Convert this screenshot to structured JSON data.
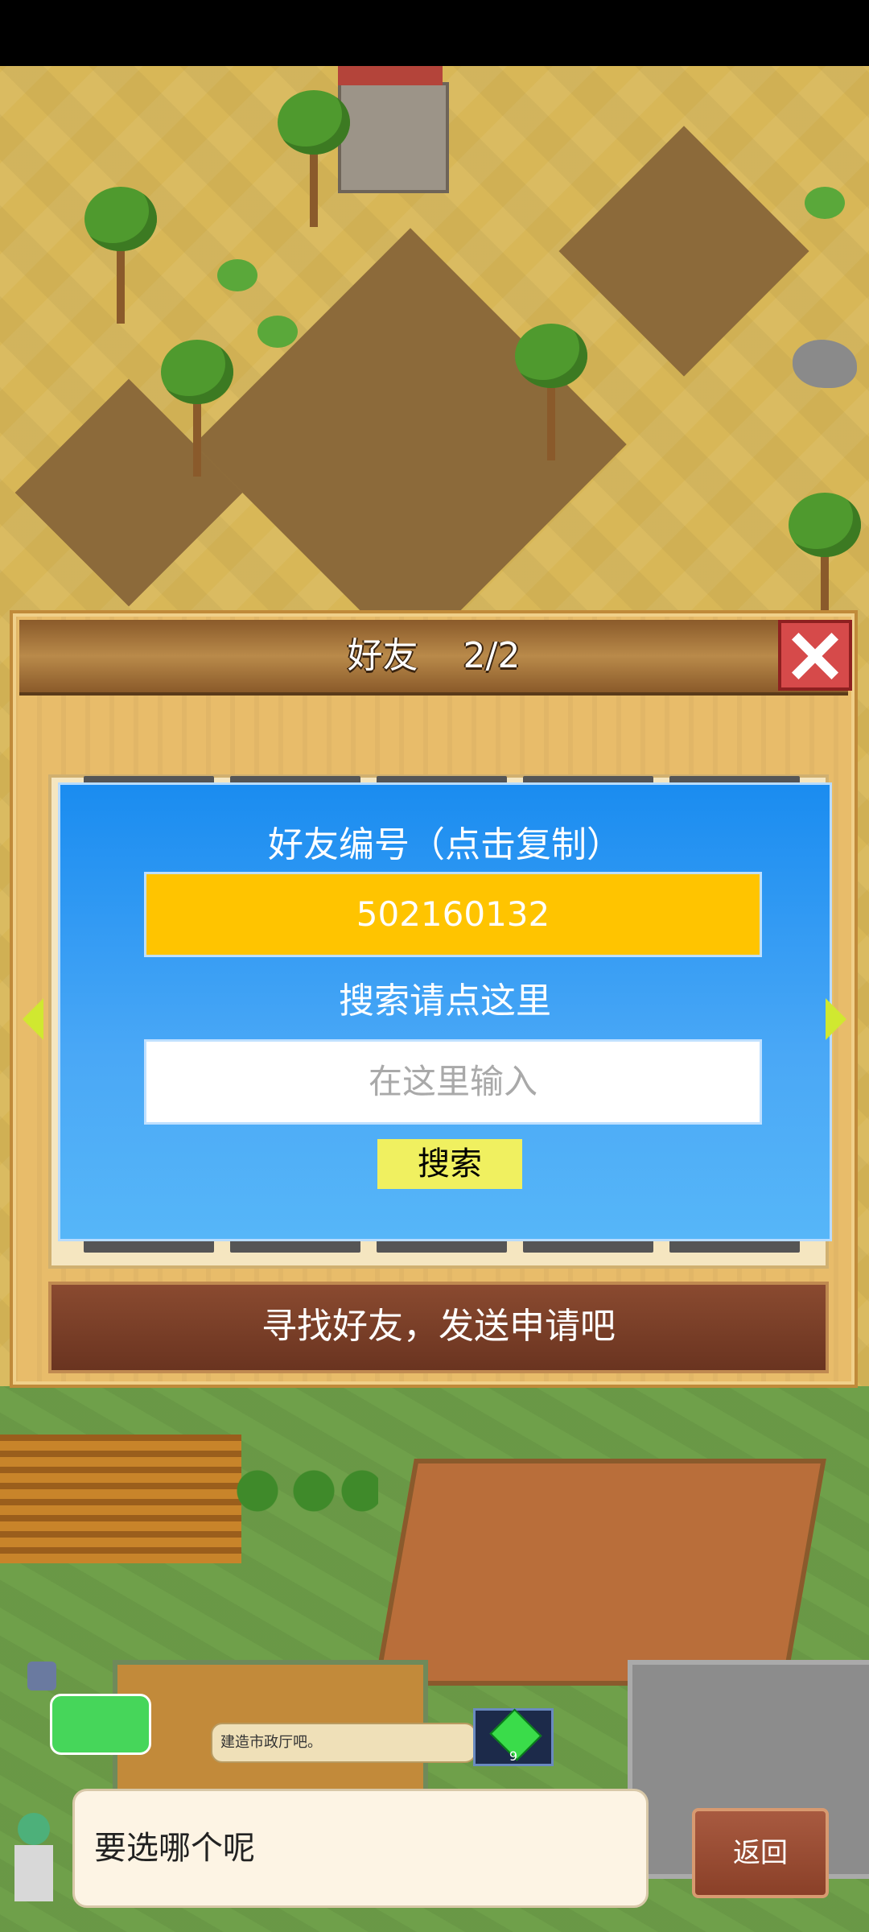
{
  "dialog": {
    "title": "好友    2/2",
    "friend_id_label": "好友编号（点击复制）",
    "friend_id_value": "502160132",
    "search_label": "搜索请点这里",
    "search_placeholder": "在这里输入",
    "search_button": "搜索",
    "footer_text": "寻找好友，发送申请吧"
  },
  "hud": {
    "hint_bubble": "建造市政厅吧。",
    "gem_count": "9",
    "message": "要选哪个呢",
    "back_button": "返回"
  },
  "colors": {
    "friend_id_bg": "#ffc400",
    "panel_blue": "#1a8cf0",
    "close_red": "#d64a4a"
  }
}
